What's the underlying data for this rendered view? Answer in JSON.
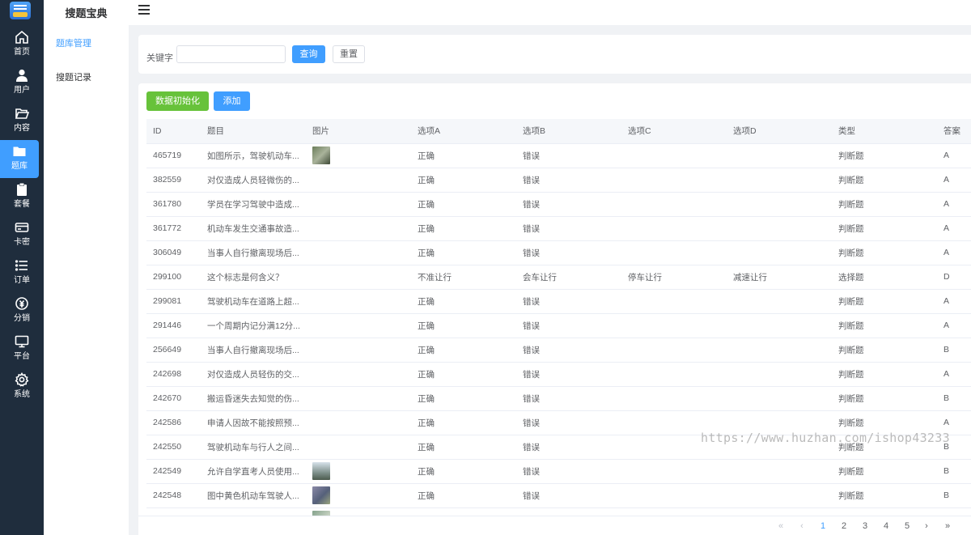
{
  "rail": {
    "items": [
      {
        "label": "首页",
        "icon": "home-icon"
      },
      {
        "label": "用户",
        "icon": "user-icon"
      },
      {
        "label": "内容",
        "icon": "folder-open-icon"
      },
      {
        "label": "题库",
        "icon": "folder-icon",
        "active": true
      },
      {
        "label": "套餐",
        "icon": "clipboard-icon"
      },
      {
        "label": "卡密",
        "icon": "card-icon"
      },
      {
        "label": "订单",
        "icon": "list-icon"
      },
      {
        "label": "分销",
        "icon": "coin-icon"
      },
      {
        "label": "平台",
        "icon": "monitor-icon"
      },
      {
        "label": "系统",
        "icon": "gear-icon"
      }
    ]
  },
  "submenu": {
    "title": "搜题宝典",
    "items": [
      {
        "label": "题库管理",
        "active": true
      },
      {
        "label": "搜题记录",
        "active": false
      }
    ]
  },
  "search": {
    "keyword_label": "关键字",
    "keyword_value": "",
    "keyword_placeholder": "",
    "query_label": "查询",
    "reset_label": "重置"
  },
  "actions": {
    "init_label": "数据初始化",
    "add_label": "添加"
  },
  "table": {
    "columns": [
      "ID",
      "题目",
      "图片",
      "选项A",
      "选项B",
      "选项C",
      "选项D",
      "类型",
      "答案"
    ],
    "rows": [
      {
        "id": "465719",
        "title": "如图所示，驾驶机动车...",
        "image": "t1",
        "a": "正确",
        "b": "错误",
        "c": "",
        "d": "",
        "type": "判断题",
        "answer": "A"
      },
      {
        "id": "382559",
        "title": "对仅造成人员轻微伤的...",
        "image": "",
        "a": "正确",
        "b": "错误",
        "c": "",
        "d": "",
        "type": "判断题",
        "answer": "A"
      },
      {
        "id": "361780",
        "title": "学员在学习驾驶中造成...",
        "image": "",
        "a": "正确",
        "b": "错误",
        "c": "",
        "d": "",
        "type": "判断题",
        "answer": "A"
      },
      {
        "id": "361772",
        "title": "机动车发生交通事故造...",
        "image": "",
        "a": "正确",
        "b": "错误",
        "c": "",
        "d": "",
        "type": "判断题",
        "answer": "A"
      },
      {
        "id": "306049",
        "title": "当事人自行撤离现场后...",
        "image": "",
        "a": "正确",
        "b": "错误",
        "c": "",
        "d": "",
        "type": "判断题",
        "answer": "A"
      },
      {
        "id": "299100",
        "title": "这个标志是何含义？",
        "image": "",
        "a": "不准让行",
        "b": "会车让行",
        "c": "停车让行",
        "d": "减速让行",
        "type": "选择题",
        "answer": "D"
      },
      {
        "id": "299081",
        "title": "驾驶机动车在道路上超...",
        "image": "",
        "a": "正确",
        "b": "错误",
        "c": "",
        "d": "",
        "type": "判断题",
        "answer": "A"
      },
      {
        "id": "291446",
        "title": "一个周期内记分满12分...",
        "image": "",
        "a": "正确",
        "b": "错误",
        "c": "",
        "d": "",
        "type": "判断题",
        "answer": "A"
      },
      {
        "id": "256649",
        "title": "当事人自行撤离现场后...",
        "image": "",
        "a": "正确",
        "b": "错误",
        "c": "",
        "d": "",
        "type": "判断题",
        "answer": "B"
      },
      {
        "id": "242698",
        "title": "对仅造成人员轻伤的交...",
        "image": "",
        "a": "正确",
        "b": "错误",
        "c": "",
        "d": "",
        "type": "判断题",
        "answer": "A"
      },
      {
        "id": "242670",
        "title": "搬运昏迷失去知觉的伤...",
        "image": "",
        "a": "正确",
        "b": "错误",
        "c": "",
        "d": "",
        "type": "判断题",
        "answer": "B"
      },
      {
        "id": "242586",
        "title": "申请人因故不能按照预...",
        "image": "",
        "a": "正确",
        "b": "错误",
        "c": "",
        "d": "",
        "type": "判断题",
        "answer": "A"
      },
      {
        "id": "242550",
        "title": "驾驶机动车与行人之间...",
        "image": "",
        "a": "正确",
        "b": "错误",
        "c": "",
        "d": "",
        "type": "判断题",
        "answer": "B"
      },
      {
        "id": "242549",
        "title": "允许自学直考人员使用...",
        "image": "t2",
        "a": "正确",
        "b": "错误",
        "c": "",
        "d": "",
        "type": "判断题",
        "answer": "B"
      },
      {
        "id": "242548",
        "title": "图中黄色机动车驾驶人...",
        "image": "t3",
        "a": "正确",
        "b": "错误",
        "c": "",
        "d": "",
        "type": "判断题",
        "answer": "B"
      },
      {
        "id": "",
        "title": "",
        "image": "t4",
        "a": "",
        "b": "",
        "c": "",
        "d": "",
        "type": "",
        "answer": ""
      }
    ]
  },
  "pager": {
    "first": "«",
    "prev": "‹",
    "pages": [
      "1",
      "2",
      "3",
      "4",
      "5"
    ],
    "current": "1",
    "next": "›",
    "last": "»"
  },
  "watermark": "https://www.huzhan.com/ishop43233",
  "colors": {
    "rail_bg": "#1f2d3d",
    "primary": "#409eff",
    "success": "#67c23a"
  }
}
